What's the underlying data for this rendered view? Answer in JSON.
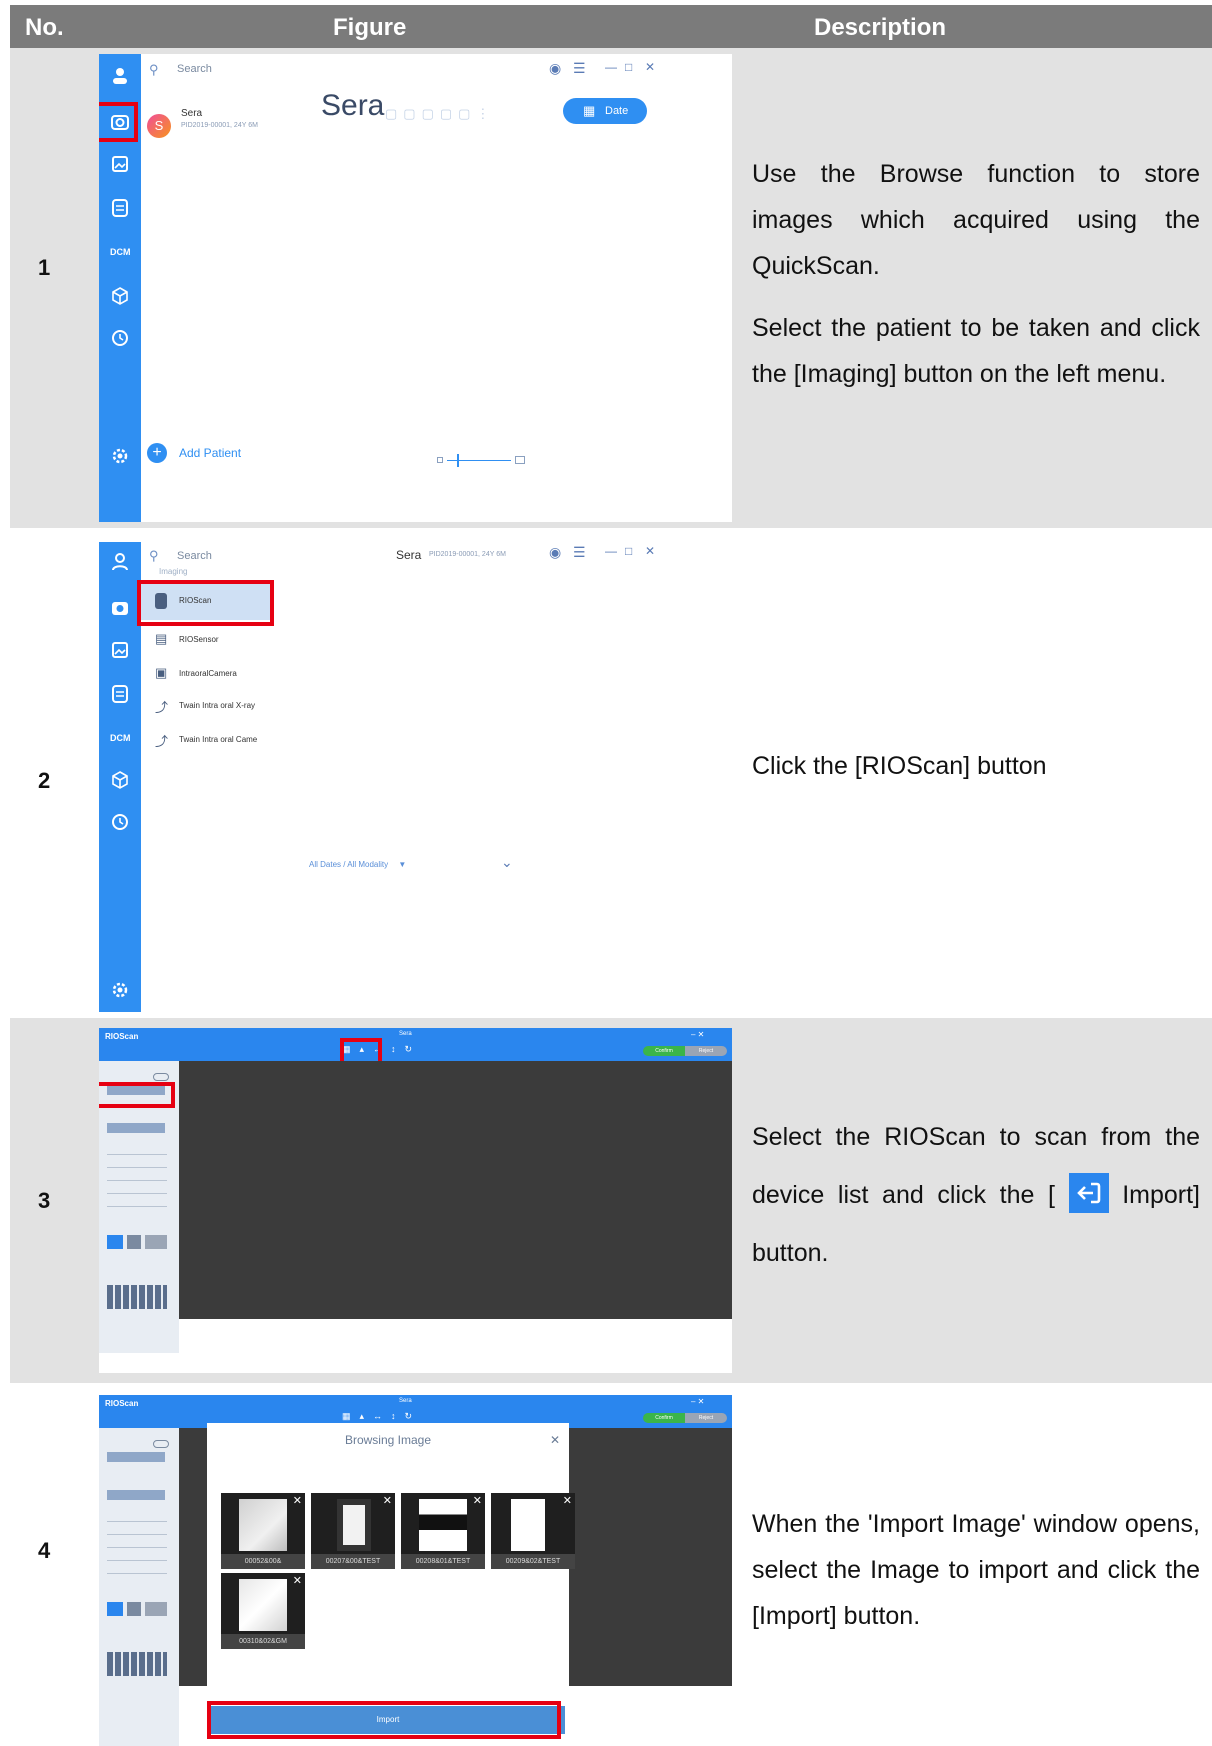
{
  "header": {
    "no": "No.",
    "figure": "Figure",
    "description": "Description"
  },
  "rows": [
    {
      "no": "1",
      "desc": [
        "Use the Browse function to store images which acquired using the QuickScan.",
        "Select the patient to be taken and click the [Imaging] button on the left menu."
      ],
      "fig": {
        "search_placeholder": "Search",
        "patient_name": "Sera",
        "patient_info": "PID2019-00001, 24Y 6M",
        "avatar_letter": "S",
        "title": "Sera",
        "date_button": "Date",
        "add_patient": "Add Patient"
      }
    },
    {
      "no": "2",
      "desc": [
        "Click the [RIOScan] button"
      ],
      "fig": {
        "search_placeholder": "Search",
        "section": "Imaging",
        "items": [
          "RIOScan",
          "RIOSensor",
          "IntraoralCamera",
          "Twain Intra oral X-ray",
          "Twain Intra oral Came"
        ],
        "title_name": "Sera",
        "title_info": "PID2019-00001, 24Y 6M",
        "filter": "All Dates / All Modality"
      }
    },
    {
      "no": "3",
      "desc_pre": "Select the RIOScan to scan from the device list and click the [",
      "desc_post": "Import] button.",
      "fig": {
        "app_name": "RIOScan",
        "title": "Sera",
        "confirm": "Confirm",
        "reject": "Reject"
      }
    },
    {
      "no": "4",
      "desc": [
        "When the 'Import Image' window opens, select the Image to import and click the [Import] button."
      ],
      "fig": {
        "app_name": "RIOScan",
        "title": "Sera",
        "confirm": "Confirm",
        "reject": "Reject",
        "dialog_title": "Browsing Image",
        "thumbs": [
          "00052&00&",
          "00207&00&TEST",
          "00208&01&TEST",
          "00209&02&TEST",
          "00310&02&GM"
        ],
        "import_button": "Import"
      }
    }
  ],
  "colors": {
    "header_bg": "#7b7b7b",
    "row_bg": "#e2e2e2",
    "app_blue": "#2f8ff2",
    "highlight_red": "#e60012"
  }
}
